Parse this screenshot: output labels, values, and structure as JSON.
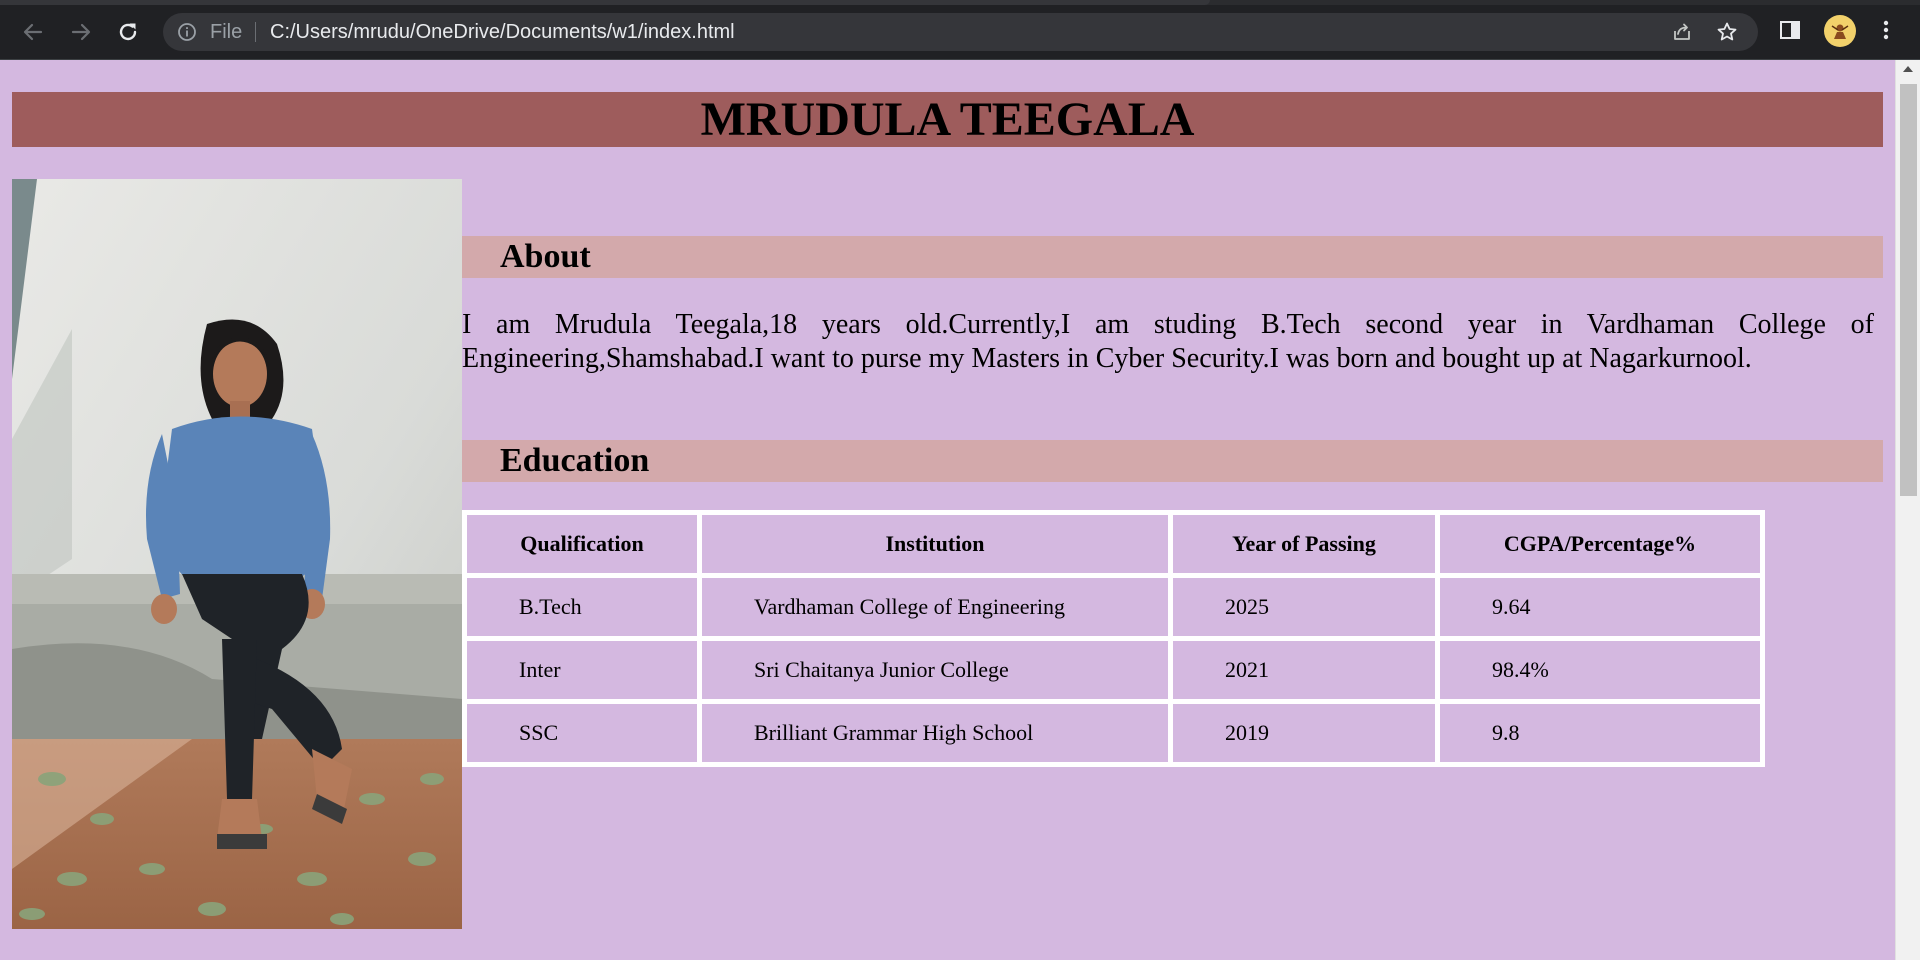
{
  "browser": {
    "protocol_label": "File",
    "url": "C:/Users/mrudu/OneDrive/Documents/w1/index.html"
  },
  "page": {
    "name_heading": "MRUDULA TEEGALA",
    "about": {
      "heading": "About",
      "text": "I am Mrudula Teegala,18 years old.Currently,I am studing B.Tech second year in Vardhaman College of Engineering,Shamshabad.I want to purse my Masters in Cyber Security.I was born and bought up at  Nagarkurnool."
    },
    "education": {
      "heading": "Education",
      "columns": [
        "Qualification",
        "Institution",
        "Year of Passing",
        "CGPA/Percentage%"
      ],
      "rows": [
        [
          "B.Tech",
          "Vardhaman College of Engineering",
          "2025",
          "9.64"
        ],
        [
          "Inter",
          "Sri Chaitanya Junior College",
          "2021",
          "98.4%"
        ],
        [
          "SSC",
          "Brilliant Grammar High School",
          "2019",
          "9.8"
        ]
      ]
    },
    "colors": {
      "page_background": "#d4b8e0",
      "title_bar": "#9e5c5c",
      "section_bar": "#d3a9ab"
    }
  },
  "icons": {
    "back": "arrow-left-icon",
    "forward": "arrow-right-icon",
    "reload": "reload-icon",
    "info": "info-icon",
    "share": "share-icon",
    "bookmark": "star-icon",
    "side_panel": "side-panel-icon",
    "profile": "avatar",
    "menu": "kebab-menu-icon"
  }
}
